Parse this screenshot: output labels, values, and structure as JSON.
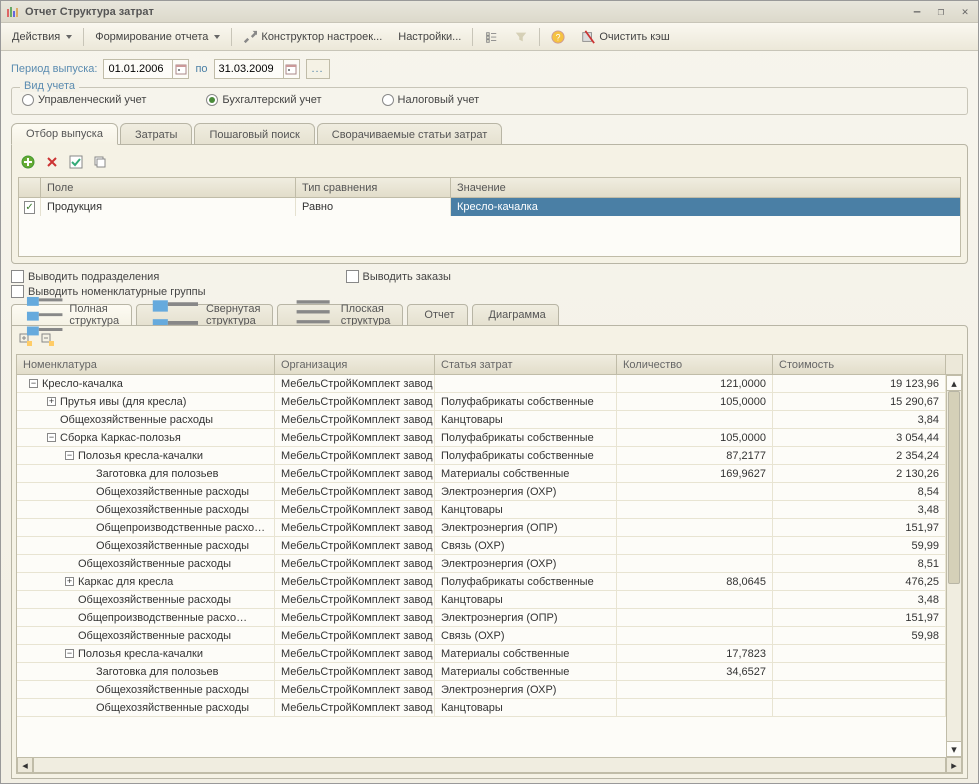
{
  "window": {
    "title": "Отчет  Структура затрат",
    "minimize": "—",
    "restore": "❐",
    "close": "✕"
  },
  "toolbar": {
    "actions": "Действия",
    "form_report": "Формирование отчета",
    "constructor": "Конструктор настроек...",
    "settings": "Настройки...",
    "clear_cache": "Очистить кэш"
  },
  "period": {
    "label": "Период выпуска:",
    "from": "01.01.2006",
    "to_label": "по",
    "to": "31.03.2009"
  },
  "accounting": {
    "legend": "Вид учета",
    "management": "Управленческий учет",
    "bookkeeping": "Бухгалтерский учет",
    "tax": "Налоговый учет",
    "selected": "Бухгалтерский учет"
  },
  "upper_tabs": {
    "filter": "Отбор выпуска",
    "costs": "Затраты",
    "search": "Пошаговый поиск",
    "collapsed": "Сворачиваемые статьи затрат"
  },
  "filter": {
    "headers": {
      "field": "Поле",
      "comparison": "Тип сравнения",
      "value": "Значение"
    },
    "row": {
      "checked": true,
      "field": "Продукция",
      "comparison": "Равно",
      "value": "Кресло-качалка"
    }
  },
  "out_checks": {
    "divisions": "Выводить подразделения",
    "item_groups": "Выводить номенклатурные группы",
    "orders": "Выводить заказы"
  },
  "lower_tabs": {
    "full": "Полная структура",
    "collapsed": "Свернутая структура",
    "flat": "Плоская структура",
    "report": "Отчет",
    "chart": "Диаграмма"
  },
  "grid": {
    "headers": {
      "nom": "Номенклатура",
      "org": "Организация",
      "st": "Статья затрат",
      "qty": "Количество",
      "cost": "Стоимость"
    },
    "org": "МебельСтройКомплект завод",
    "rows": [
      {
        "level": 0,
        "icon": "minus",
        "nom": "Кресло-качалка",
        "st": "",
        "qty": "121,0000",
        "cost": "19 123,96"
      },
      {
        "level": 1,
        "icon": "plus",
        "nom": "Прутья ивы (для кресла)",
        "st": "Полуфабрикаты собственные",
        "qty": "105,0000",
        "cost": "15 290,67"
      },
      {
        "level": 1,
        "icon": "none",
        "nom": "Общехозяйственные расходы",
        "st": "Канцтовары",
        "qty": "",
        "cost": "3,84"
      },
      {
        "level": 1,
        "icon": "minus",
        "nom": "Сборка Каркас-полозья",
        "st": "Полуфабрикаты собственные",
        "qty": "105,0000",
        "cost": "3 054,44"
      },
      {
        "level": 2,
        "icon": "minus",
        "nom": "Полозья кресла-качалки",
        "st": "Полуфабрикаты собственные",
        "qty": "87,2177",
        "cost": "2 354,24"
      },
      {
        "level": 3,
        "icon": "none",
        "nom": "Заготовка для полозьев",
        "st": "Материалы собственные",
        "qty": "169,9627",
        "cost": "2 130,26"
      },
      {
        "level": 3,
        "icon": "none",
        "nom": "Общехозяйственные расходы",
        "st": "Электроэнергия (ОХР)",
        "qty": "",
        "cost": "8,54"
      },
      {
        "level": 3,
        "icon": "none",
        "nom": "Общехозяйственные расходы",
        "st": "Канцтовары",
        "qty": "",
        "cost": "3,48"
      },
      {
        "level": 3,
        "icon": "none",
        "nom": "Общепроизводственные расхо…",
        "st": "Электроэнергия (ОПР)",
        "qty": "",
        "cost": "151,97"
      },
      {
        "level": 3,
        "icon": "none",
        "nom": "Общехозяйственные расходы",
        "st": "Связь (ОХР)",
        "qty": "",
        "cost": "59,99"
      },
      {
        "level": 2,
        "icon": "none",
        "nom": "Общехозяйственные расходы",
        "st": "Электроэнергия (ОХР)",
        "qty": "",
        "cost": "8,51"
      },
      {
        "level": 2,
        "icon": "plus",
        "nom": "Каркас для кресла",
        "st": "Полуфабрикаты собственные",
        "qty": "88,0645",
        "cost": "476,25"
      },
      {
        "level": 2,
        "icon": "none",
        "nom": "Общехозяйственные расходы",
        "st": "Канцтовары",
        "qty": "",
        "cost": "3,48"
      },
      {
        "level": 2,
        "icon": "none",
        "nom": "Общепроизводственные расхо…",
        "st": "Электроэнергия (ОПР)",
        "qty": "",
        "cost": "151,97"
      },
      {
        "level": 2,
        "icon": "none",
        "nom": "Общехозяйственные расходы",
        "st": "Связь (ОХР)",
        "qty": "",
        "cost": "59,98"
      },
      {
        "level": 2,
        "icon": "minus",
        "nom": "Полозья кресла-качалки",
        "st": "Материалы собственные",
        "qty": "17,7823",
        "cost": ""
      },
      {
        "level": 3,
        "icon": "none",
        "nom": "Заготовка для полозьев",
        "st": "Материалы собственные",
        "qty": "34,6527",
        "cost": ""
      },
      {
        "level": 3,
        "icon": "none",
        "nom": "Общехозяйственные расходы",
        "st": "Электроэнергия (ОХР)",
        "qty": "",
        "cost": ""
      },
      {
        "level": 3,
        "icon": "none",
        "nom": "Общехозяйственные расходы",
        "st": "Канцтовары",
        "qty": "",
        "cost": ""
      }
    ]
  }
}
